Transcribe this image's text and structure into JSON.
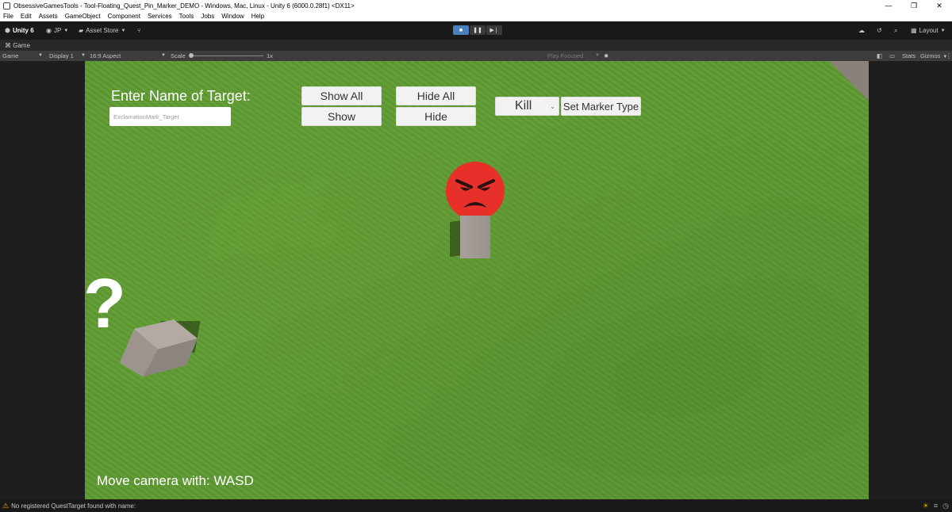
{
  "window": {
    "title": "ObsessiveGamesTools - Tool-Floating_Quest_Pin_Marker_DEMO - Windows, Mac, Linux - Unity 6 (6000.0.28f1) <DX11>",
    "controls": [
      "—",
      "❐",
      "✕"
    ]
  },
  "menu": [
    "File",
    "Edit",
    "Assets",
    "GameObject",
    "Component",
    "Services",
    "Tools",
    "Jobs",
    "Window",
    "Help"
  ],
  "toolbar": {
    "unity_label": "Unity 6",
    "account": "JP",
    "asset_store": "Asset Store",
    "layout": "Layout"
  },
  "tab": {
    "label": "Game"
  },
  "gamebar": {
    "mode": "Game",
    "display": "Display 1",
    "aspect": "16:9 Aspect",
    "scale_label": "Scale",
    "scale_value": "1x",
    "play_focused": "Play Focused",
    "stats": "Stats",
    "gizmos": "Gizmos"
  },
  "game_ui": {
    "target_label": "Enter Name of Target:",
    "target_input": "ExclamationMark_Target",
    "show_all": "Show All",
    "hide_all": "Hide All",
    "show": "Show",
    "hide": "Hide",
    "marker_type": "Kill",
    "set_marker_type": "Set Marker Type",
    "question_marker": "?",
    "hint": "Move camera with: WASD"
  },
  "status": {
    "message": "No registered QuestTarget found with name:"
  },
  "colors": {
    "grass": "#5d9a32",
    "angry_face": "#e8302a",
    "editor_bg": "#191919"
  }
}
